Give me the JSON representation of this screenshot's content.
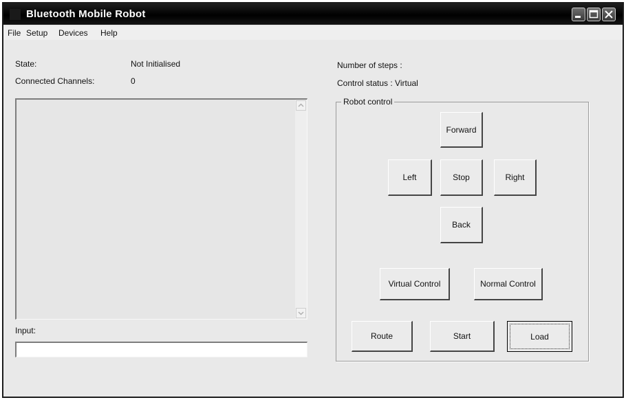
{
  "window": {
    "title": "Bluetooth Mobile Robot"
  },
  "menu": {
    "items": [
      "File",
      "Setup",
      "Devices",
      "Help"
    ]
  },
  "status": {
    "state_label": "State:",
    "state_value": "Not Initialised",
    "channels_label": "Connected Channels:",
    "channels_value": "0",
    "steps_label": "Number of steps :",
    "control_status": "Control status : Virtual"
  },
  "input": {
    "label": "Input:",
    "value": ""
  },
  "robot_control": {
    "title": "Robot control",
    "forward": "Forward",
    "left": "Left",
    "stop": "Stop",
    "right": "Right",
    "back": "Back",
    "virtual_control": "Virtual Control",
    "normal_control": "Normal Control",
    "route": "Route",
    "start": "Start",
    "load": "Load"
  },
  "icons": {
    "app": "app-icon",
    "minimize": "minimize-icon",
    "maximize": "maximize-icon",
    "close": "close-icon",
    "scroll_up": "scroll-up-arrow-icon",
    "scroll_down": "scroll-down-arrow-icon"
  }
}
